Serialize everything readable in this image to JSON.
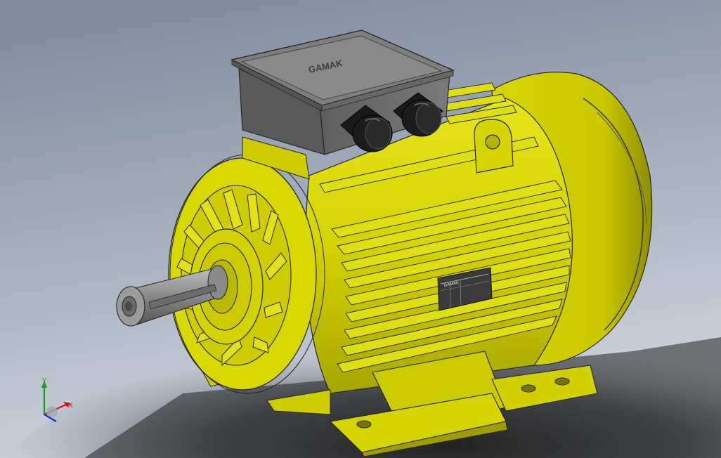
{
  "model": {
    "box_lid_brand": "GAMAK",
    "nameplate_brand": "GAMAK"
  },
  "triad": {
    "x_label": "X",
    "y_label": "Y"
  },
  "colors": {
    "body_yellow": "#d9d800",
    "body_yellow_light": "#e8e81a",
    "body_yellow_dark": "#9e9c00",
    "terminal_box_gray": "#6f6f6f",
    "cable_gland_black": "#1a1a1a",
    "shaft_gray": "#9a9a9a",
    "background_top": "#7f8da2",
    "background_bottom": "#c6cdd7",
    "axis_x": "#d01010",
    "axis_y": "#18a018",
    "axis_z": "#1030d0"
  }
}
